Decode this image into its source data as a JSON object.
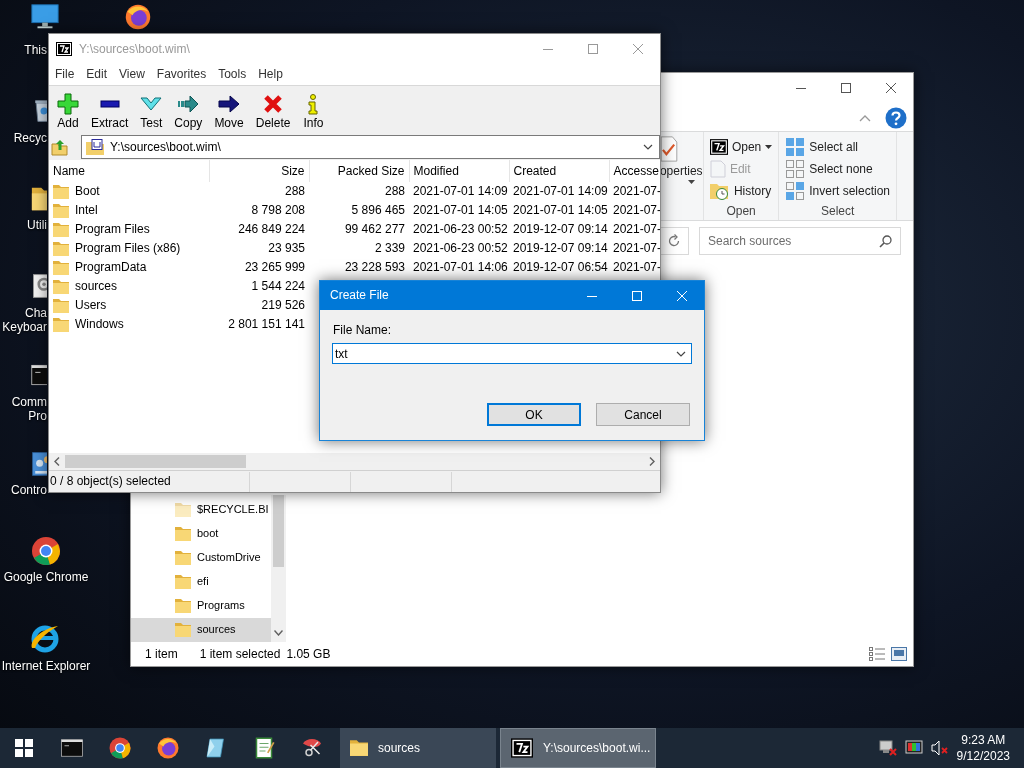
{
  "desktop_icons": [
    {
      "kind": "pc",
      "label": "This"
    },
    {
      "kind": "firefox"
    },
    {
      "kind": "recycle",
      "label": "Recyc"
    },
    {
      "kind": "folder",
      "label": "Utili"
    },
    {
      "kind": "settings",
      "label": "Cha\nKeyboar"
    },
    {
      "kind": "cmd",
      "label": "Comm\nPro"
    },
    {
      "kind": "control",
      "label": "Contro"
    },
    {
      "kind": "chrome",
      "label": "Google Chrome"
    },
    {
      "kind": "ie",
      "label": "Internet Explorer"
    }
  ],
  "explorer": {
    "ribbon": {
      "properties_label": "operties",
      "open_group": {
        "label": "Open",
        "items": [
          {
            "kind": "open",
            "label": "Open",
            "disabled": false,
            "dropdown": true
          },
          {
            "kind": "edit",
            "label": "Edit",
            "disabled": true,
            "dropdown": false
          },
          {
            "kind": "history",
            "label": "History",
            "disabled": false,
            "dropdown": false
          }
        ]
      },
      "select_group": {
        "label": "Select",
        "items": [
          {
            "kind": "select_all",
            "label": "Select all"
          },
          {
            "kind": "select_none",
            "label": "Select none"
          },
          {
            "kind": "invert",
            "label": "Invert selection"
          }
        ]
      }
    },
    "search": {
      "placeholder": "Search sources"
    },
    "nav_items": [
      {
        "label": "$RECYCLE.BI",
        "hidden": true,
        "selected": false
      },
      {
        "label": "boot",
        "hidden": false,
        "selected": false
      },
      {
        "label": "CustomDrive",
        "hidden": false,
        "selected": false
      },
      {
        "label": "efi",
        "hidden": false,
        "selected": false
      },
      {
        "label": "Programs",
        "hidden": false,
        "selected": false
      },
      {
        "label": "sources",
        "hidden": false,
        "selected": true
      }
    ],
    "status": {
      "count": "1 item",
      "selection": "1 item selected",
      "size": "1.05 GB"
    }
  },
  "archive_window": {
    "title": "Y:\\sources\\boot.wim\\",
    "active": false,
    "menu": [
      "File",
      "Edit",
      "View",
      "Favorites",
      "Tools",
      "Help"
    ],
    "toolbar": [
      {
        "kind": "add",
        "label": "Add"
      },
      {
        "kind": "extract",
        "label": "Extract"
      },
      {
        "kind": "test",
        "label": "Test"
      },
      {
        "kind": "copy",
        "label": "Copy"
      },
      {
        "kind": "move",
        "label": "Move"
      },
      {
        "kind": "delete",
        "label": "Delete"
      },
      {
        "kind": "info",
        "label": "Info"
      }
    ],
    "address": "Y:\\sources\\boot.wim\\",
    "columns": [
      "Name",
      "Size",
      "Packed Size",
      "Modified",
      "Created",
      "Accesse"
    ],
    "rows": [
      {
        "name": "Boot",
        "size": "288",
        "packed_size": "288",
        "modified": "2021-07-01 14:09",
        "created": "2021-07-01 14:09",
        "accessed": "2021-07-"
      },
      {
        "name": "Intel",
        "size": "8 798 208",
        "packed_size": "5 896 465",
        "modified": "2021-07-01 14:05",
        "created": "2021-07-01 14:05",
        "accessed": "2021-07-"
      },
      {
        "name": "Program Files",
        "size": "246 849 224",
        "packed_size": "99 462 277",
        "modified": "2021-06-23 00:52",
        "created": "2019-12-07 09:14",
        "accessed": "2021-07-"
      },
      {
        "name": "Program Files (x86)",
        "size": "23 935",
        "packed_size": "2 339",
        "modified": "2021-06-23 00:52",
        "created": "2019-12-07 09:14",
        "accessed": "2021-07-"
      },
      {
        "name": "ProgramData",
        "size": "23 265 999",
        "packed_size": "23 228 593",
        "modified": "2021-07-01 14:06",
        "created": "2019-12-07 06:54",
        "accessed": "2021-07-"
      },
      {
        "name": "sources",
        "size": "1 544 224"
      },
      {
        "name": "Users",
        "size": "219 526"
      },
      {
        "name": "Windows",
        "size": "2 801 151 141"
      }
    ],
    "status": "0 / 8 object(s) selected"
  },
  "dialog": {
    "title": "Create File",
    "label": "File Name:",
    "value": "txt",
    "buttons": [
      {
        "label": "OK",
        "default": true
      },
      {
        "label": "Cancel",
        "default": false
      }
    ]
  },
  "taskbar": {
    "pinned": [
      {
        "kind": "cmd"
      },
      {
        "kind": "chrome"
      },
      {
        "kind": "firefox"
      },
      {
        "kind": "crystal"
      },
      {
        "kind": "notepad"
      },
      {
        "kind": "paint"
      }
    ],
    "windows": [
      {
        "kind": "folder",
        "label": "sources",
        "active": false
      },
      {
        "kind": "archive",
        "label": "Y:\\sources\\boot.wi...",
        "active": true
      }
    ],
    "clock": {
      "time": "9:23 AM",
      "date": "9/12/2023"
    }
  }
}
